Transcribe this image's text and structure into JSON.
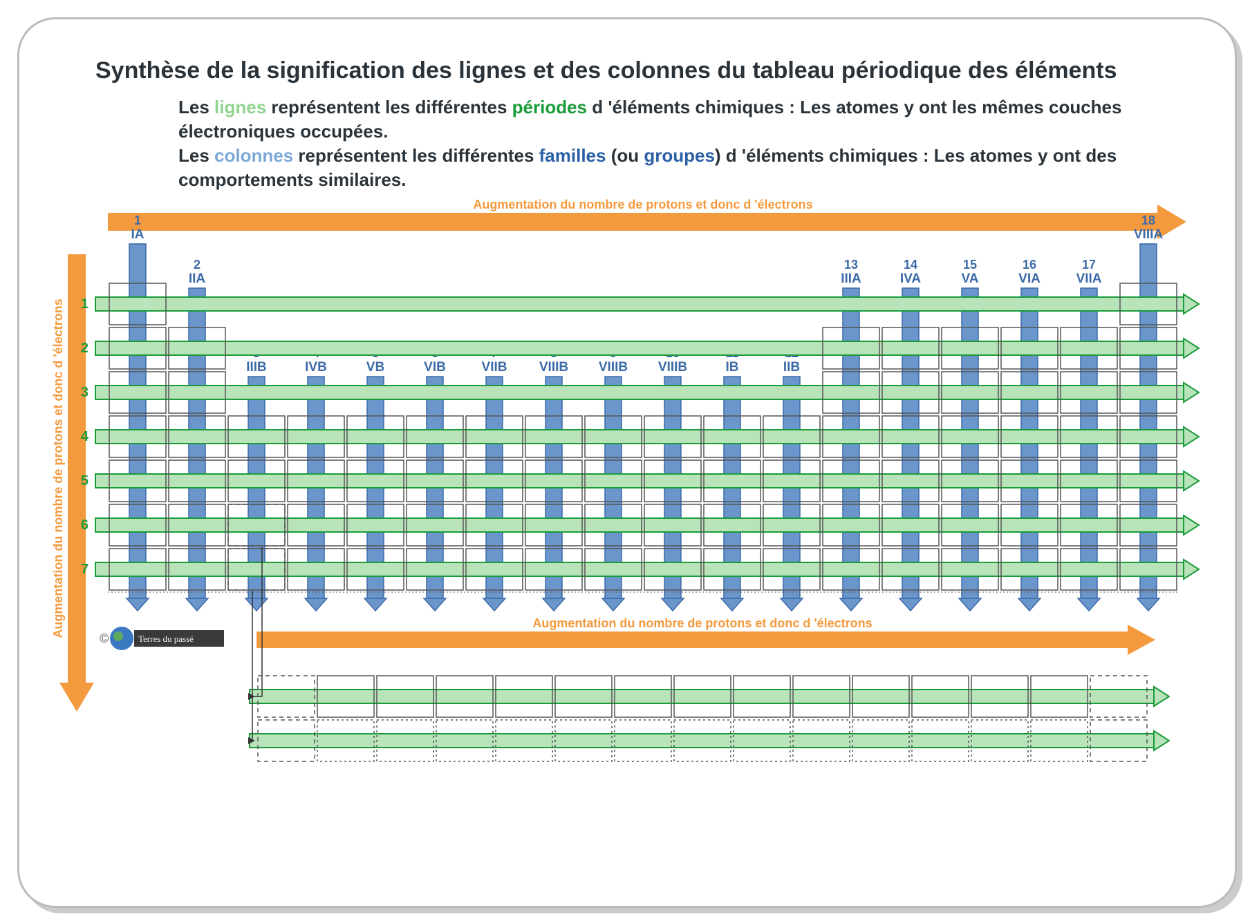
{
  "title": "Synthèse de la signification des lignes et des colonnes du tableau périodique des éléments",
  "desc": {
    "p1_a": "Les ",
    "p1_b": "lignes",
    "p1_c": " représentent les  différentes ",
    "p1_d": "périodes",
    "p1_e": " d 'éléments chimiques : Les atomes y ont les mêmes couches électroniques occupées.",
    "p2_a": "Les ",
    "p2_b": "colonnes",
    "p2_c": " représentent les  différentes ",
    "p2_d": "familles",
    "p2_e": " (ou ",
    "p2_f": "groupes",
    "p2_g": ") d 'éléments chimiques : Les atomes y ont des comportements similaires."
  },
  "arrowLabel": "Augmentation du nombre de protons et donc d 'électrons",
  "colors": {
    "orange": "#f39a3e",
    "blue": "#6b96cc",
    "blueStroke": "#3b6aa8",
    "green": "#1a9b3a",
    "lgreen": "#b9e4b9",
    "cellStroke": "#555"
  },
  "columns": [
    {
      "num": "1",
      "roman": "IA",
      "startRow": 1
    },
    {
      "num": "2",
      "roman": "IIA",
      "startRow": 2
    },
    {
      "num": "3",
      "roman": "IIIB",
      "startRow": 4
    },
    {
      "num": "4",
      "roman": "IVB",
      "startRow": 4
    },
    {
      "num": "5",
      "roman": "VB",
      "startRow": 4
    },
    {
      "num": "6",
      "roman": "VIB",
      "startRow": 4
    },
    {
      "num": "7",
      "roman": "VIIB",
      "startRow": 4
    },
    {
      "num": "8",
      "roman": "VIIIB",
      "startRow": 4
    },
    {
      "num": "9",
      "roman": "VIIIB",
      "startRow": 4
    },
    {
      "num": "10",
      "roman": "VIIIB",
      "startRow": 4
    },
    {
      "num": "11",
      "roman": "IB",
      "startRow": 4
    },
    {
      "num": "12",
      "roman": "IIB",
      "startRow": 4
    },
    {
      "num": "13",
      "roman": "IIIA",
      "startRow": 2
    },
    {
      "num": "14",
      "roman": "IVA",
      "startRow": 2
    },
    {
      "num": "15",
      "roman": "VA",
      "startRow": 2
    },
    {
      "num": "16",
      "roman": "VIA",
      "startRow": 2
    },
    {
      "num": "17",
      "roman": "VIIA",
      "startRow": 2
    },
    {
      "num": "18",
      "roman": "VIIIA",
      "startRow": 1
    }
  ],
  "periods": [
    "1",
    "2",
    "3",
    "4",
    "5",
    "6",
    "7"
  ],
  "rowShape": [
    [
      1,
      18
    ],
    [
      1,
      2,
      13,
      14,
      15,
      16,
      17,
      18
    ],
    [
      1,
      2,
      13,
      14,
      15,
      16,
      17,
      18
    ],
    [
      1,
      2,
      3,
      4,
      5,
      6,
      7,
      8,
      9,
      10,
      11,
      12,
      13,
      14,
      15,
      16,
      17,
      18
    ],
    [
      1,
      2,
      3,
      4,
      5,
      6,
      7,
      8,
      9,
      10,
      11,
      12,
      13,
      14,
      15,
      16,
      17,
      18
    ],
    [
      1,
      2,
      3,
      4,
      5,
      6,
      7,
      8,
      9,
      10,
      11,
      12,
      13,
      14,
      15,
      16,
      17,
      18
    ],
    [
      1,
      2,
      3,
      4,
      5,
      6,
      7,
      8,
      9,
      10,
      11,
      12,
      13,
      14,
      15,
      16,
      17,
      18
    ]
  ],
  "fblock": {
    "cols": 15,
    "rows": 2
  },
  "logo": "Terres du passé"
}
